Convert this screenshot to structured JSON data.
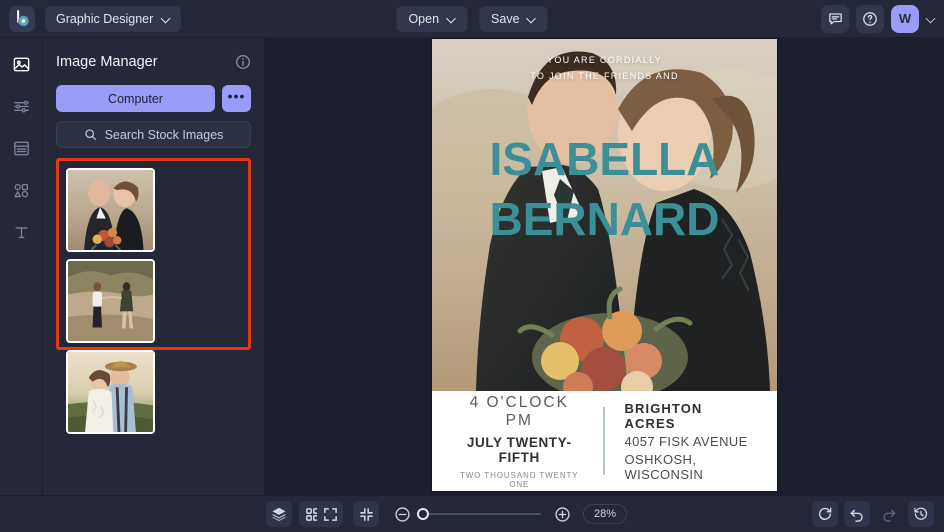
{
  "topbar": {
    "logo_name": "befunky-logo",
    "doc_name": "Graphic Designer",
    "open_label": "Open",
    "save_label": "Save",
    "chat_icon": "chat-icon",
    "help_icon": "help-circle-icon",
    "avatar_initial": "W"
  },
  "rail": {
    "items": [
      {
        "label": "Image Manager",
        "icon": "image-icon",
        "active": true
      },
      {
        "label": "Edit",
        "icon": "sliders-icon",
        "active": false
      },
      {
        "label": "Templates",
        "icon": "layout-icon",
        "active": false
      },
      {
        "label": "Graphics",
        "icon": "shapes-icon",
        "active": false
      },
      {
        "label": "Text",
        "icon": "text-icon",
        "active": false
      }
    ]
  },
  "panel": {
    "title": "Image Manager",
    "info_icon": "info-circle-icon",
    "computer_label": "Computer",
    "more_label": "•••",
    "search_label": "Search Stock Images",
    "search_icon": "search-icon",
    "highlight_color": "#e8361a",
    "accent_color": "#9b9cf8",
    "thumbnails": [
      {
        "name": "wedding-couple-bouquet"
      },
      {
        "name": "couple-holding-hands-field"
      },
      {
        "name": "couple-hat-kiss-sunset"
      }
    ]
  },
  "canvas": {
    "invite_line1": "YOU ARE CORDIALLY",
    "invite_line2": "TO JOIN THE FRIENDS AND",
    "name_first": "ISABELLA",
    "name_last": "BERNARD",
    "name_color": "#3d8f97",
    "time": "4 O'CLOCK PM",
    "date": "JULY TWENTY-FIFTH",
    "year": "TWO THOUSAND TWENTY ONE",
    "venue": "BRIGHTON ACRES",
    "address": "4057 FISK AVENUE",
    "city": "OSHKOSH, WISCONSIN"
  },
  "bottombar": {
    "layers_icon": "layers-icon",
    "grid_icon": "grid-icon",
    "fit_icon": "expand-frame-icon",
    "shrink_icon": "collapse-frame-icon",
    "zoom_out_icon": "zoom-out-icon",
    "zoom_in_icon": "zoom-in-icon",
    "zoom_level": "28%",
    "reset_icon": "reset-icon",
    "undo_icon": "undo-icon",
    "redo_icon": "redo-icon",
    "history_icon": "history-icon"
  }
}
